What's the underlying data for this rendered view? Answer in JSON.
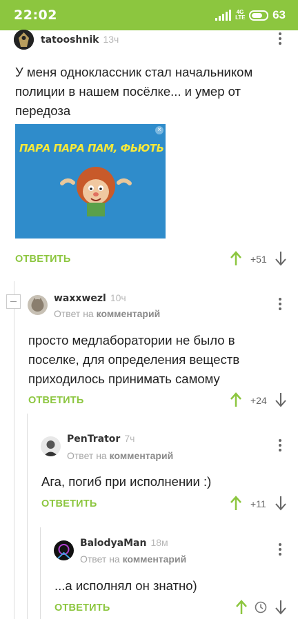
{
  "status_bar": {
    "time": "22:02",
    "network": "4G LTE",
    "battery": "63"
  },
  "colors": {
    "accent": "#8cc63f",
    "status_bar": "#8cc63f",
    "image_bg": "#2f8ccb"
  },
  "post": {
    "author": "tatooshnik",
    "time": "13ч",
    "text": "У меня одноклассник стал начальником полиции в нашем посёлке... и умер от передоза",
    "image_caption": "ПАРА ПАРА ПАМ, ФЬЮТЬ",
    "reply_label": "ОТВЕТИТЬ",
    "rating": "+51"
  },
  "comments": [
    {
      "author": "waxxwezl",
      "time": "10ч",
      "reply_prefix": "Ответ на",
      "reply_target": "комментарий",
      "text": "просто медлаборатории не было в поселке, для определения веществ приходилось принимать самому",
      "reply_label": "ОТВЕТИТЬ",
      "rating": "+24"
    },
    {
      "author": "PenTrator",
      "time": "7ч",
      "reply_prefix": "Ответ на",
      "reply_target": "комментарий",
      "text": "Ага, погиб при исполнении :)",
      "reply_label": "ОТВЕТИТЬ",
      "rating": "+11"
    },
    {
      "author": "BalodyaMan",
      "time": "18м",
      "reply_prefix": "Ответ на",
      "reply_target": "комментарий",
      "text": "...а исполнял он знатно)",
      "reply_label": "ОТВЕТИТЬ",
      "rating": ""
    }
  ],
  "icons": [
    "more-vert-icon",
    "upvote-arrow-icon",
    "downvote-arrow-icon",
    "clock-icon",
    "collapse-icon"
  ]
}
